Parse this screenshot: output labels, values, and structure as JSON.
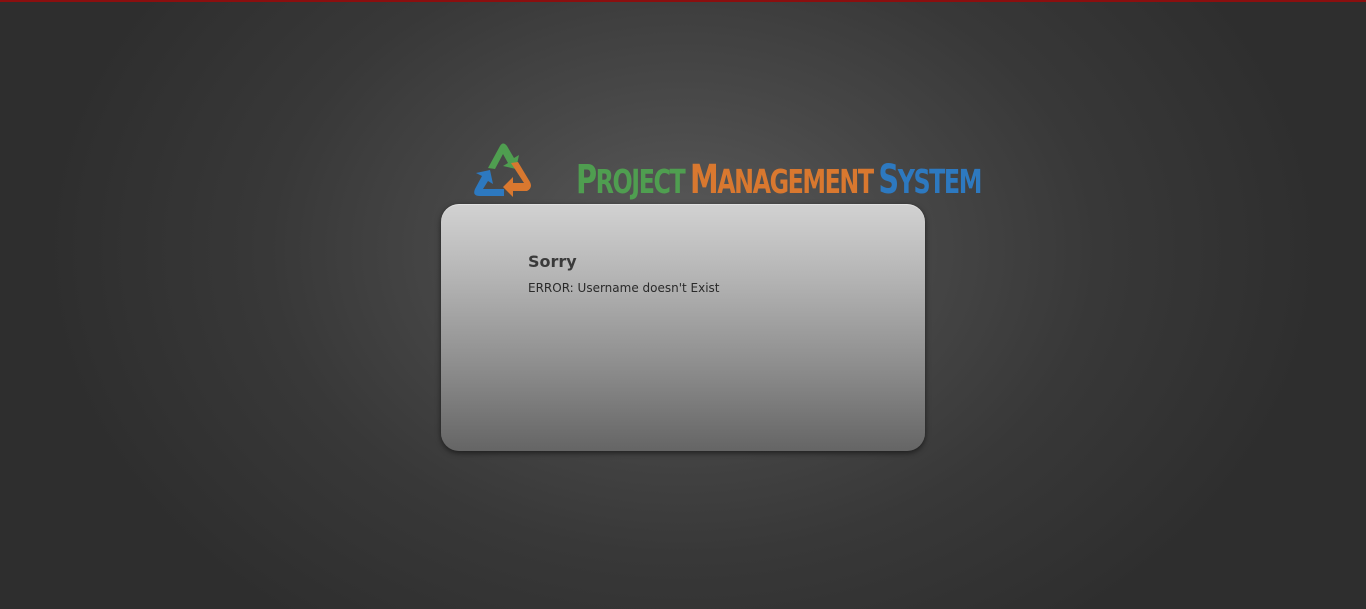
{
  "logo": {
    "icon": "recycle-icon",
    "words": {
      "project_initial": "P",
      "project_rest": "ROJECT",
      "management_initial": "M",
      "management_rest": "ANAGEMENT",
      "system_initial": "S",
      "system_rest": "YSTEM"
    },
    "colors": {
      "project": "#4f9e50",
      "management": "#d9782f",
      "system": "#2d79c0"
    }
  },
  "panel": {
    "title": "Sorry",
    "message": "ERROR: Username doesn't Exist"
  },
  "colors": {
    "top_bar": "#8b0f0f"
  }
}
